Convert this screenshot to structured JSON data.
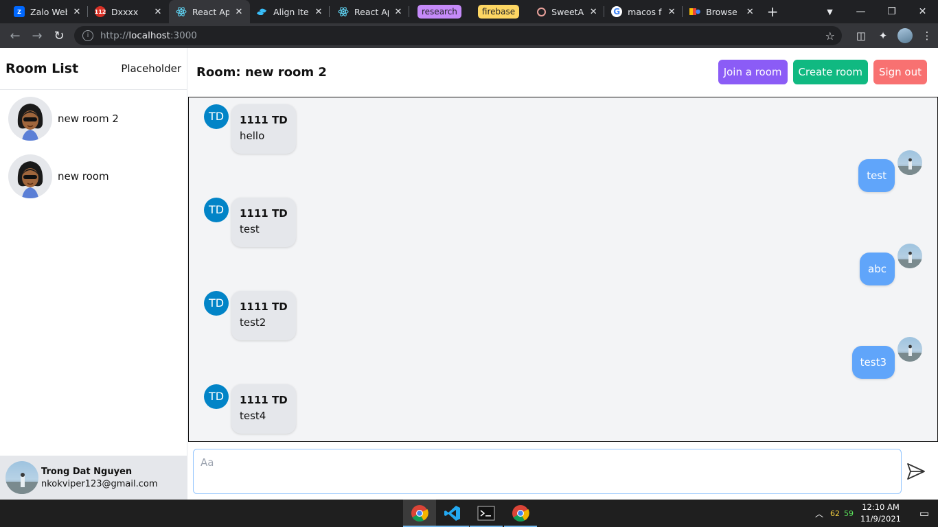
{
  "browser": {
    "tabs": [
      {
        "title": "Zalo Web",
        "favicon": "zalo-icon",
        "active": false
      },
      {
        "title": "Dxxxx",
        "favicon": "calendar-112-icon",
        "active": false
      },
      {
        "title": "React App",
        "favicon": "react-icon",
        "active": true
      },
      {
        "title": "Align Items",
        "favicon": "tailwind-icon",
        "active": false
      },
      {
        "title": "React App",
        "favicon": "react-icon",
        "active": false
      },
      {
        "title": "SweetAlert",
        "favicon": "sweetalert-icon",
        "active": false
      },
      {
        "title": "macos font",
        "favicon": "google-icon",
        "active": false
      },
      {
        "title": "Browse Fonts",
        "favicon": "google-fonts-icon",
        "active": false
      }
    ],
    "tab_groups": [
      {
        "label": "research",
        "color": "#c58af9"
      },
      {
        "label": "firebase",
        "color": "#fdd663"
      }
    ],
    "url_prefix": "http://",
    "url_host": "localhost",
    "url_port": ":3000"
  },
  "sidebar": {
    "title": "Room List",
    "placeholder": "Placeholder",
    "rooms": [
      {
        "name": "new room 2"
      },
      {
        "name": "new room"
      }
    ],
    "user": {
      "name": "Trong Dat Nguyen",
      "email": "nkokviper123@gmail.com"
    }
  },
  "main": {
    "room_title": "Room: new room 2",
    "join_label": "Join a room",
    "create_label": "Create room",
    "signout_label": "Sign out",
    "composer_placeholder": "Aa",
    "messages": [
      {
        "side": "in",
        "initials": "TD",
        "sender": "1111 TD",
        "text": "hello"
      },
      {
        "side": "out",
        "text": "test"
      },
      {
        "side": "in",
        "initials": "TD",
        "sender": "1111 TD",
        "text": "test"
      },
      {
        "side": "out",
        "text": "abc"
      },
      {
        "side": "in",
        "initials": "TD",
        "sender": "1111 TD",
        "text": "test2"
      },
      {
        "side": "out",
        "text": "test3"
      },
      {
        "side": "in",
        "initials": "TD",
        "sender": "1111 TD",
        "text": "test4"
      }
    ]
  },
  "taskbar": {
    "apps": [
      "chrome-icon",
      "vscode-icon",
      "terminal-icon",
      "chrome-canary-icon"
    ],
    "tray_num1": "62",
    "tray_num2": "59",
    "time": "12:10 AM",
    "date": "11/9/2021"
  },
  "colors": {
    "join": "#8b5cf6",
    "create": "#10b981",
    "signout": "#f87171",
    "outgoing_bubble": "#60a5fa",
    "incoming_avatar": "#0284c7"
  }
}
